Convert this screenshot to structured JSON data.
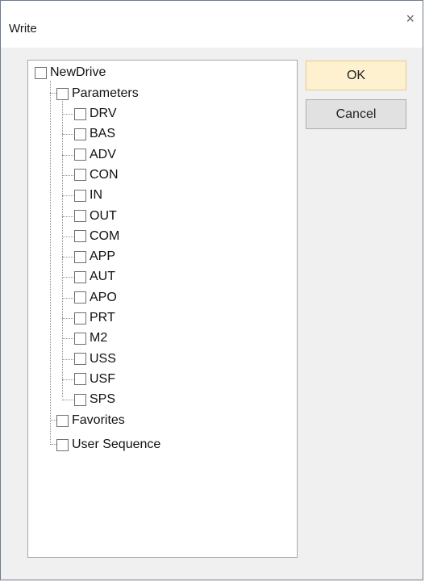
{
  "window": {
    "title": "Write",
    "close_glyph": "×"
  },
  "buttons": {
    "ok_label": "OK",
    "cancel_label": "Cancel"
  },
  "tree": {
    "root": "NewDrive",
    "parameters": "Parameters",
    "parameter_items": [
      "DRV",
      "BAS",
      "ADV",
      "CON",
      "IN",
      "OUT",
      "COM",
      "APP",
      "AUT",
      "APO",
      "PRT",
      "M2",
      "USS",
      "USF",
      "SPS"
    ],
    "favorites": "Favorites",
    "user_sequence": "User Sequence"
  }
}
